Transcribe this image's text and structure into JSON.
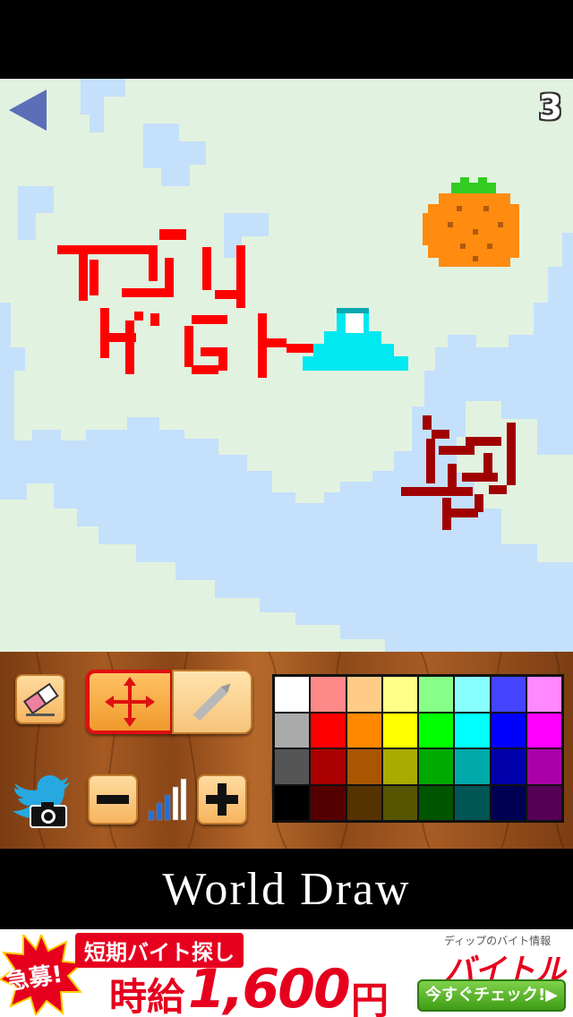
{
  "canvas": {
    "page_number": "3",
    "colors": {
      "ocean": "#c4e0fb",
      "land": "#e2f2e0",
      "red_drawing": "#ff0000",
      "dark_red_drawing": "#a00000",
      "mountain_cyan": "#00e8f0",
      "mountain_snow": "#ffffff",
      "orange_fruit": "#ff8c10",
      "leaf_green": "#33cc22"
    },
    "icons": {
      "back": "back-arrow-icon"
    }
  },
  "toolbar": {
    "icons": {
      "eraser": "eraser-icon",
      "move": "move-arrows-icon",
      "pencil": "pencil-icon",
      "share": "twitter-camera-icon",
      "minus": "minus-icon",
      "plus": "plus-icon",
      "brush_size": "signal-bars-icon"
    },
    "brush_size_level": 3,
    "brush_size_max": 5,
    "active_tool": "move",
    "selected_color": "#ff0000",
    "palette": [
      "#ffffff",
      "#ff8888",
      "#ffcc88",
      "#ffff88",
      "#88ff88",
      "#88ffff",
      "#4444ff",
      "#ff88ff",
      "#aaaaaa",
      "#ff0000",
      "#ff8800",
      "#ffff00",
      "#00ff00",
      "#00ffff",
      "#0000ff",
      "#ff00ff",
      "#555555",
      "#aa0000",
      "#aa5500",
      "#aaaa00",
      "#00aa00",
      "#00aaaa",
      "#0000aa",
      "#aa00aa",
      "#000000",
      "#550000",
      "#553300",
      "#555500",
      "#005500",
      "#005555",
      "#000055",
      "#550055"
    ]
  },
  "app": {
    "title": "World Draw"
  },
  "ad": {
    "burst_text": "急募!",
    "headline": "短期バイト探し",
    "wage_label": "時給",
    "wage_amount": "1,600",
    "wage_unit": "円",
    "brand_sub": "ディップのバイト情報",
    "brand": "バイトル",
    "cta": "今すぐチェック!▶"
  }
}
